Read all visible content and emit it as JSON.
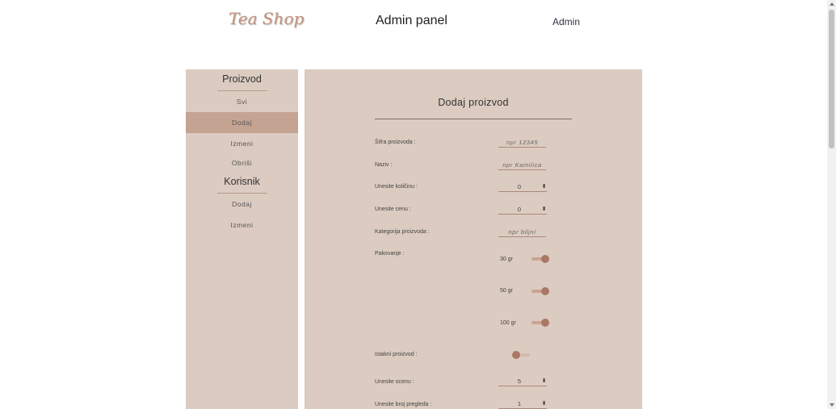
{
  "header": {
    "brand": "Tea Shop",
    "title": "Admin panel",
    "user": "Admin"
  },
  "sidebar": {
    "sections": [
      {
        "heading": "Proizvod",
        "items": [
          {
            "label": "Svi",
            "active": false
          },
          {
            "label": "Dodaj",
            "active": true
          },
          {
            "label": "Izmeni",
            "active": false
          },
          {
            "label": "Obriši",
            "active": false
          }
        ]
      },
      {
        "heading": "Korisnik",
        "items": [
          {
            "label": "Dodaj",
            "active": false
          },
          {
            "label": "Izmeni",
            "active": false
          }
        ]
      }
    ]
  },
  "form": {
    "title": "Dodaj proizvod",
    "fields": {
      "sifra": {
        "label": "Šifra proizvoda :",
        "placeholder": "npr 12345"
      },
      "naziv": {
        "label": "Naziv :",
        "placeholder": "npr Kamilica"
      },
      "kolicina": {
        "label": "Unesite količinu :",
        "value": "0"
      },
      "cena": {
        "label": "Unesite cenu :",
        "value": "0"
      },
      "kategorija": {
        "label": "Kategorija proizvoda :",
        "placeholder": "npr biljni"
      },
      "pakovanje": {
        "label": "Pakovanje :",
        "options": [
          {
            "label": "30 gr",
            "on": true
          },
          {
            "label": "50 gr",
            "on": true
          },
          {
            "label": "100 gr",
            "on": true
          }
        ]
      },
      "istaknut": {
        "label": "Istakni proizvod :",
        "on": false
      },
      "ocena": {
        "label": "Unesite ocenu :",
        "value": "5"
      },
      "pregledi": {
        "label": "Unesite broj pregleda :",
        "value": "1"
      }
    }
  },
  "colors": {
    "panel_bg": "#dccbc0",
    "active_item": "#c4a392",
    "accent": "#a97863",
    "brand": "#c4917a"
  }
}
